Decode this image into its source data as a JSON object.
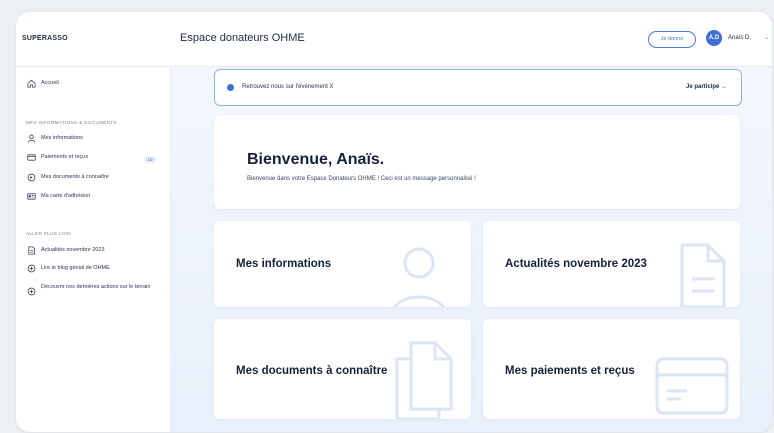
{
  "header": {
    "brand": "SUPERASSO",
    "title": "Espace donateurs OHME",
    "donate_label": "Je donne",
    "avatar_initials": "A.D",
    "user_name": "Anaïs D.",
    "accent_color": "#3f6ed6"
  },
  "sidebar": {
    "home_label": "Accueil",
    "section1_title": "MES INFORMATIONS & DOCUMENTS",
    "items1": [
      {
        "label": "Mes informations",
        "icon": "user-icon"
      },
      {
        "label": "Paiements et reçus",
        "icon": "card-icon"
      },
      {
        "label": "Mes documents à connaître",
        "icon": "document-icon"
      },
      {
        "label": "Ma carte d'adhésion",
        "icon": "id-card-icon"
      }
    ],
    "payments_badge": "10",
    "section2_title": "ALLER PLUS LOIN",
    "items2": [
      {
        "label": "Actualités novembre 2023",
        "icon": "news-icon"
      },
      {
        "label": "Lire le blog génial de OHME",
        "icon": "plus-circle-icon"
      },
      {
        "label": "Découvrir nos dernières actions sur le terrain",
        "icon": "plus-circle-icon"
      }
    ]
  },
  "main": {
    "banner_message": "Retrouvez nous sur l'événement X",
    "banner_cta": "Je participe →",
    "welcome_title": "Bienvenue, Anaïs.",
    "welcome_subtitle": "Bienvenue dans votre Espace Donateurs OHME ! Ceci est un message personnalisé !",
    "cards": [
      {
        "title": "Mes informations",
        "icon": "user-icon"
      },
      {
        "title": "Actualités novembre 2023",
        "icon": "document-icon"
      },
      {
        "title": "Mes documents à connaître",
        "icon": "documents-icon"
      },
      {
        "title": "Mes paiements et reçus",
        "icon": "card-icon"
      }
    ]
  }
}
